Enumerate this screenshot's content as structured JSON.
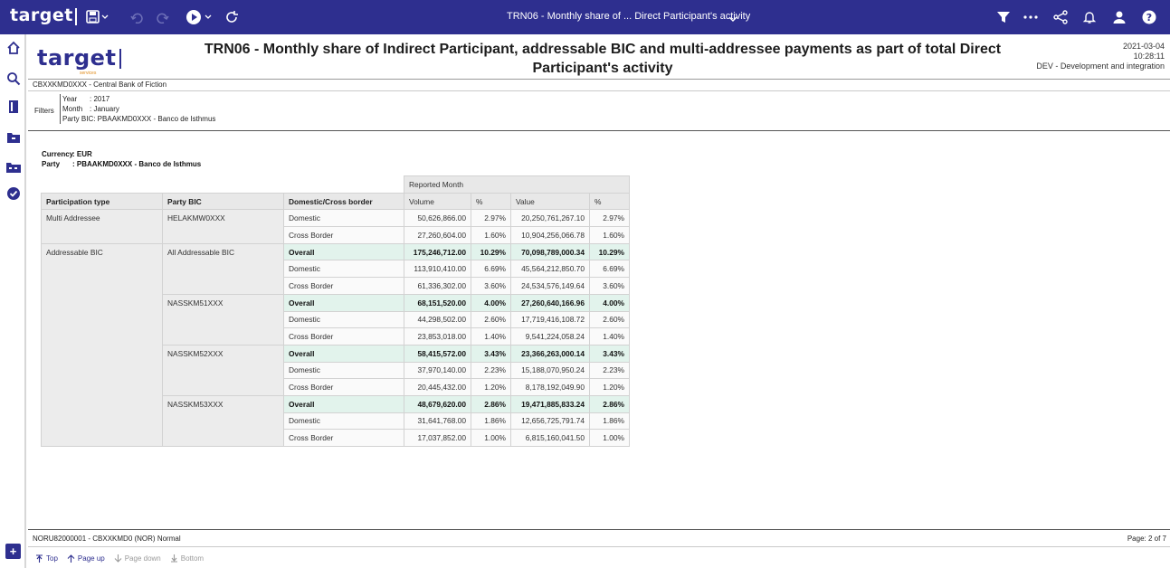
{
  "topbar": {
    "logo": "target",
    "title": "TRN06 - Monthly share of ... Direct Participant's activity",
    "icons": [
      "save-icon",
      "undo-icon",
      "redo-icon",
      "run-icon",
      "refresh-icon",
      "filter-icon",
      "more-icon",
      "share-icon",
      "bell-icon",
      "user-icon",
      "help-icon"
    ]
  },
  "rail": {
    "icons": [
      "home-icon",
      "search-icon",
      "book-icon",
      "folder-icon",
      "folders-icon",
      "check-circle-icon"
    ]
  },
  "brand": {
    "logo": "target",
    "sub": "services"
  },
  "report": {
    "title": "TRN06 - Monthly share of Indirect Participant, addressable BIC and multi-addressee payments as part of total Direct Participant's activity",
    "date": "2021-03-04",
    "time": "10:28:11",
    "environment": "DEV - Development and integration",
    "bank": "CBXXKMD0XXX - Central Bank of Fiction",
    "filters_label": "Filters",
    "filters": [
      {
        "key": "Year",
        "value": ": 2017"
      },
      {
        "key": "Month",
        "value": ": January"
      },
      {
        "key": "Party BIC",
        "value": ": PBAAKMD0XXX - Banco de Isthmus"
      }
    ],
    "currency_key": "Currency",
    "currency_value": ": EUR",
    "party_key": "Party",
    "party_value": ": PBAAKMD0XXX - Banco de Isthmus"
  },
  "table": {
    "group_header": "Reported Month",
    "headers": [
      "Participation type",
      "Party BIC",
      "Domestic/Cross border",
      "Volume",
      "%",
      "Value",
      "%"
    ],
    "groups": [
      {
        "participation": "Multi Addressee",
        "bics": [
          {
            "bic": "HELAKMW0XXX",
            "rows": [
              {
                "type": "Domestic",
                "volume": "50,626,866.00",
                "vpct": "2.97%",
                "value": "20,250,761,267.10",
                "valpct": "2.97%",
                "overall": false
              },
              {
                "type": "Cross Border",
                "volume": "27,260,604.00",
                "vpct": "1.60%",
                "value": "10,904,256,066.78",
                "valpct": "1.60%",
                "overall": false
              }
            ]
          }
        ]
      },
      {
        "participation": "Addressable BIC",
        "bics": [
          {
            "bic": "All Addressable BIC",
            "rows": [
              {
                "type": "Overall",
                "volume": "175,246,712.00",
                "vpct": "10.29%",
                "value": "70,098,789,000.34",
                "valpct": "10.29%",
                "overall": true
              },
              {
                "type": "Domestic",
                "volume": "113,910,410.00",
                "vpct": "6.69%",
                "value": "45,564,212,850.70",
                "valpct": "6.69%",
                "overall": false
              },
              {
                "type": "Cross Border",
                "volume": "61,336,302.00",
                "vpct": "3.60%",
                "value": "24,534,576,149.64",
                "valpct": "3.60%",
                "overall": false
              }
            ]
          },
          {
            "bic": "NASSKM51XXX",
            "rows": [
              {
                "type": "Overall",
                "volume": "68,151,520.00",
                "vpct": "4.00%",
                "value": "27,260,640,166.96",
                "valpct": "4.00%",
                "overall": true
              },
              {
                "type": "Domestic",
                "volume": "44,298,502.00",
                "vpct": "2.60%",
                "value": "17,719,416,108.72",
                "valpct": "2.60%",
                "overall": false
              },
              {
                "type": "Cross Border",
                "volume": "23,853,018.00",
                "vpct": "1.40%",
                "value": "9,541,224,058.24",
                "valpct": "1.40%",
                "overall": false
              }
            ]
          },
          {
            "bic": "NASSKM52XXX",
            "rows": [
              {
                "type": "Overall",
                "volume": "58,415,572.00",
                "vpct": "3.43%",
                "value": "23,366,263,000.14",
                "valpct": "3.43%",
                "overall": true
              },
              {
                "type": "Domestic",
                "volume": "37,970,140.00",
                "vpct": "2.23%",
                "value": "15,188,070,950.24",
                "valpct": "2.23%",
                "overall": false
              },
              {
                "type": "Cross Border",
                "volume": "20,445,432.00",
                "vpct": "1.20%",
                "value": "8,178,192,049.90",
                "valpct": "1.20%",
                "overall": false
              }
            ]
          },
          {
            "bic": "NASSKM53XXX",
            "rows": [
              {
                "type": "Overall",
                "volume": "48,679,620.00",
                "vpct": "2.86%",
                "value": "19,471,885,833.24",
                "valpct": "2.86%",
                "overall": true
              },
              {
                "type": "Domestic",
                "volume": "31,641,768.00",
                "vpct": "1.86%",
                "value": "12,656,725,791.74",
                "valpct": "1.86%",
                "overall": false
              },
              {
                "type": "Cross Border",
                "volume": "17,037,852.00",
                "vpct": "1.00%",
                "value": "6,815,160,041.50",
                "valpct": "1.00%",
                "overall": false
              }
            ]
          }
        ]
      }
    ]
  },
  "footer": {
    "status": "NORU82000001 - CBXXKMD0 (NOR) Normal",
    "page": "Page: 2 of 7",
    "pager": [
      {
        "label": "Top",
        "icon": "top-arrow-icon",
        "enabled": true
      },
      {
        "label": "Page up",
        "icon": "up-arrow-icon",
        "enabled": true
      },
      {
        "label": "Page down",
        "icon": "down-arrow-icon",
        "enabled": false
      },
      {
        "label": "Bottom",
        "icon": "bottom-arrow-icon",
        "enabled": false
      }
    ]
  }
}
